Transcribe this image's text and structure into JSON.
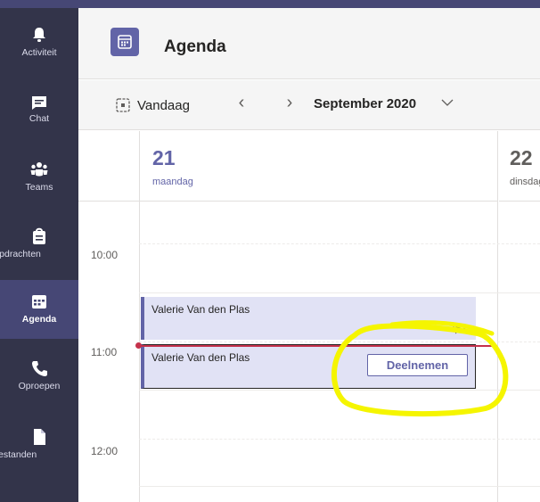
{
  "rail": {
    "items": [
      {
        "label": "Activiteit",
        "icon": "bell-icon"
      },
      {
        "label": "Chat",
        "icon": "chat-icon"
      },
      {
        "label": "Teams",
        "icon": "teams-icon"
      },
      {
        "label": "Opdrachten",
        "icon": "assignments-icon"
      },
      {
        "label": "Agenda",
        "icon": "calendar-icon",
        "active": true
      },
      {
        "label": "Oproepen",
        "icon": "phone-icon"
      },
      {
        "label": "Bestanden",
        "icon": "file-icon"
      }
    ]
  },
  "header": {
    "title": "Agenda",
    "icon": "calendar-icon"
  },
  "toolbar": {
    "today_label": "Vandaag",
    "prev_label": "‹",
    "next_label": "›",
    "month_label": "September 2020"
  },
  "days": [
    {
      "number": "21",
      "name": "maandag"
    },
    {
      "number": "22",
      "name": "dinsdag"
    }
  ],
  "times": [
    "10:00",
    "11:00",
    "12:00"
  ],
  "events": [
    {
      "title": "Valerie Van den Plas",
      "has_chat": true
    },
    {
      "title": "Valerie Van den Plas",
      "action_label": "Deelnemen"
    }
  ],
  "colors": {
    "accent": "#6264a7",
    "rail": "#33344a",
    "now_line": "#c4314b",
    "highlight": "#f5f500"
  }
}
